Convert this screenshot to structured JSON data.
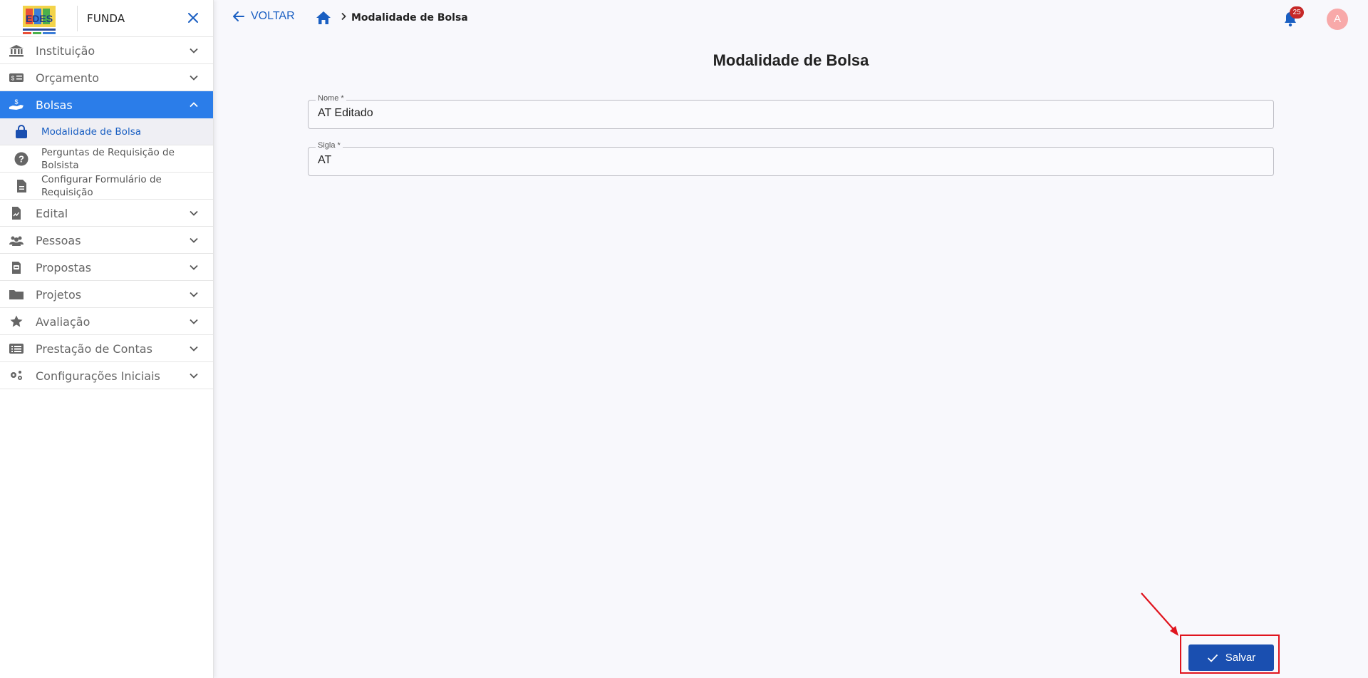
{
  "sidebar": {
    "brand": "FUNDA",
    "items": [
      {
        "label": "Instituição",
        "icon": "bank-icon"
      },
      {
        "label": "Orçamento",
        "icon": "money-icon"
      },
      {
        "label": "Bolsas",
        "icon": "hand-coin-icon",
        "expanded": true
      },
      {
        "label": "Edital",
        "icon": "document-chart-icon"
      },
      {
        "label": "Pessoas",
        "icon": "people-icon"
      },
      {
        "label": "Propostas",
        "icon": "clipboard-icon"
      },
      {
        "label": "Projetos",
        "icon": "folder-icon"
      },
      {
        "label": "Avaliação",
        "icon": "star-icon"
      },
      {
        "label": "Prestação de Contas",
        "icon": "list-icon"
      },
      {
        "label": "Configurações Iniciais",
        "icon": "gears-icon"
      }
    ],
    "subitems": [
      {
        "label": "Modalidade de Bolsa",
        "icon": "bag-icon",
        "selected": true
      },
      {
        "label1": "Perguntas de Requisição de",
        "label2": "Bolsista",
        "icon": "question-icon"
      },
      {
        "label1": "Configurar Formulário de",
        "label2": "Requisição",
        "icon": "file-icon"
      }
    ]
  },
  "topbar": {
    "back_label": "VOLTAR",
    "breadcrumb_current": "Modalidade de Bolsa",
    "notification_count": "25",
    "avatar_initial": "A"
  },
  "main": {
    "title": "Modalidade de Bolsa",
    "fields": {
      "nome": {
        "label": "Nome *",
        "value": "AT Editado"
      },
      "sigla": {
        "label": "Sigla *",
        "value": "AT"
      }
    },
    "save_label": "Salvar"
  },
  "colors": {
    "primary": "#1a4fb0",
    "active_nav": "#2b7de9",
    "badge": "#c62828",
    "highlight": "#e0141e"
  }
}
